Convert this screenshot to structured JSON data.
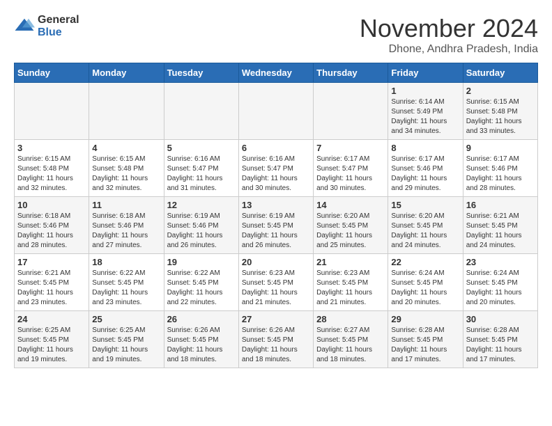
{
  "header": {
    "logo_general": "General",
    "logo_blue": "Blue",
    "month_title": "November 2024",
    "subtitle": "Dhone, Andhra Pradesh, India"
  },
  "weekdays": [
    "Sunday",
    "Monday",
    "Tuesday",
    "Wednesday",
    "Thursday",
    "Friday",
    "Saturday"
  ],
  "weeks": [
    [
      {
        "day": "",
        "info": ""
      },
      {
        "day": "",
        "info": ""
      },
      {
        "day": "",
        "info": ""
      },
      {
        "day": "",
        "info": ""
      },
      {
        "day": "",
        "info": ""
      },
      {
        "day": "1",
        "info": "Sunrise: 6:14 AM\nSunset: 5:49 PM\nDaylight: 11 hours and 34 minutes."
      },
      {
        "day": "2",
        "info": "Sunrise: 6:15 AM\nSunset: 5:48 PM\nDaylight: 11 hours and 33 minutes."
      }
    ],
    [
      {
        "day": "3",
        "info": "Sunrise: 6:15 AM\nSunset: 5:48 PM\nDaylight: 11 hours and 32 minutes."
      },
      {
        "day": "4",
        "info": "Sunrise: 6:15 AM\nSunset: 5:48 PM\nDaylight: 11 hours and 32 minutes."
      },
      {
        "day": "5",
        "info": "Sunrise: 6:16 AM\nSunset: 5:47 PM\nDaylight: 11 hours and 31 minutes."
      },
      {
        "day": "6",
        "info": "Sunrise: 6:16 AM\nSunset: 5:47 PM\nDaylight: 11 hours and 30 minutes."
      },
      {
        "day": "7",
        "info": "Sunrise: 6:17 AM\nSunset: 5:47 PM\nDaylight: 11 hours and 30 minutes."
      },
      {
        "day": "8",
        "info": "Sunrise: 6:17 AM\nSunset: 5:46 PM\nDaylight: 11 hours and 29 minutes."
      },
      {
        "day": "9",
        "info": "Sunrise: 6:17 AM\nSunset: 5:46 PM\nDaylight: 11 hours and 28 minutes."
      }
    ],
    [
      {
        "day": "10",
        "info": "Sunrise: 6:18 AM\nSunset: 5:46 PM\nDaylight: 11 hours and 28 minutes."
      },
      {
        "day": "11",
        "info": "Sunrise: 6:18 AM\nSunset: 5:46 PM\nDaylight: 11 hours and 27 minutes."
      },
      {
        "day": "12",
        "info": "Sunrise: 6:19 AM\nSunset: 5:46 PM\nDaylight: 11 hours and 26 minutes."
      },
      {
        "day": "13",
        "info": "Sunrise: 6:19 AM\nSunset: 5:45 PM\nDaylight: 11 hours and 26 minutes."
      },
      {
        "day": "14",
        "info": "Sunrise: 6:20 AM\nSunset: 5:45 PM\nDaylight: 11 hours and 25 minutes."
      },
      {
        "day": "15",
        "info": "Sunrise: 6:20 AM\nSunset: 5:45 PM\nDaylight: 11 hours and 24 minutes."
      },
      {
        "day": "16",
        "info": "Sunrise: 6:21 AM\nSunset: 5:45 PM\nDaylight: 11 hours and 24 minutes."
      }
    ],
    [
      {
        "day": "17",
        "info": "Sunrise: 6:21 AM\nSunset: 5:45 PM\nDaylight: 11 hours and 23 minutes."
      },
      {
        "day": "18",
        "info": "Sunrise: 6:22 AM\nSunset: 5:45 PM\nDaylight: 11 hours and 23 minutes."
      },
      {
        "day": "19",
        "info": "Sunrise: 6:22 AM\nSunset: 5:45 PM\nDaylight: 11 hours and 22 minutes."
      },
      {
        "day": "20",
        "info": "Sunrise: 6:23 AM\nSunset: 5:45 PM\nDaylight: 11 hours and 21 minutes."
      },
      {
        "day": "21",
        "info": "Sunrise: 6:23 AM\nSunset: 5:45 PM\nDaylight: 11 hours and 21 minutes."
      },
      {
        "day": "22",
        "info": "Sunrise: 6:24 AM\nSunset: 5:45 PM\nDaylight: 11 hours and 20 minutes."
      },
      {
        "day": "23",
        "info": "Sunrise: 6:24 AM\nSunset: 5:45 PM\nDaylight: 11 hours and 20 minutes."
      }
    ],
    [
      {
        "day": "24",
        "info": "Sunrise: 6:25 AM\nSunset: 5:45 PM\nDaylight: 11 hours and 19 minutes."
      },
      {
        "day": "25",
        "info": "Sunrise: 6:25 AM\nSunset: 5:45 PM\nDaylight: 11 hours and 19 minutes."
      },
      {
        "day": "26",
        "info": "Sunrise: 6:26 AM\nSunset: 5:45 PM\nDaylight: 11 hours and 18 minutes."
      },
      {
        "day": "27",
        "info": "Sunrise: 6:26 AM\nSunset: 5:45 PM\nDaylight: 11 hours and 18 minutes."
      },
      {
        "day": "28",
        "info": "Sunrise: 6:27 AM\nSunset: 5:45 PM\nDaylight: 11 hours and 18 minutes."
      },
      {
        "day": "29",
        "info": "Sunrise: 6:28 AM\nSunset: 5:45 PM\nDaylight: 11 hours and 17 minutes."
      },
      {
        "day": "30",
        "info": "Sunrise: 6:28 AM\nSunset: 5:45 PM\nDaylight: 11 hours and 17 minutes."
      }
    ]
  ]
}
